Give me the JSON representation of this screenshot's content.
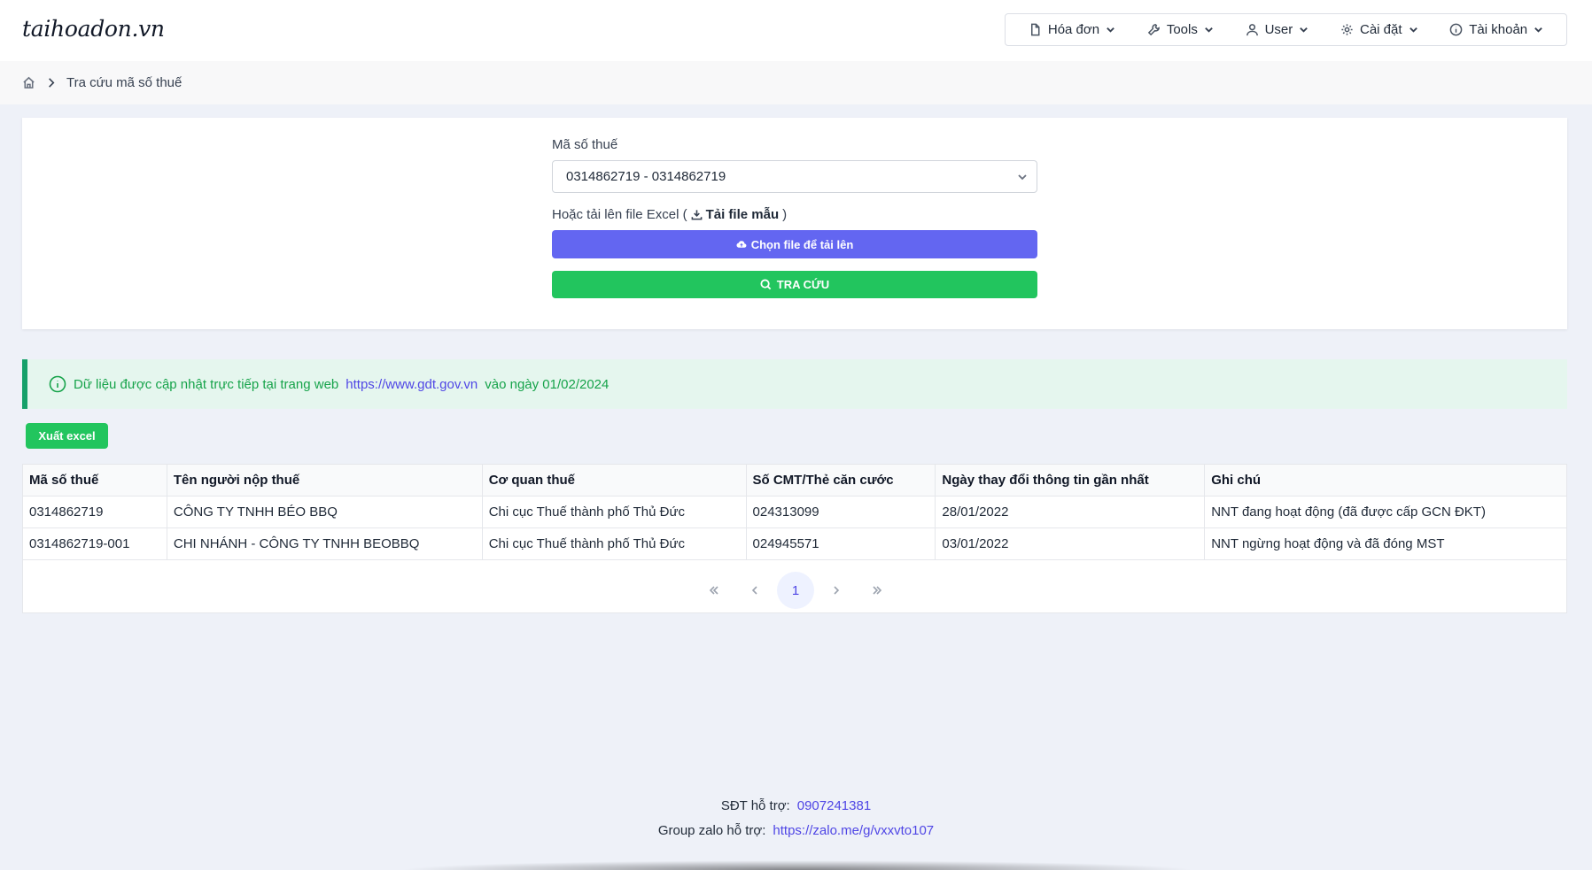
{
  "app": {
    "logo": "taihoadon.vn"
  },
  "nav": {
    "items": [
      {
        "label": "Hóa đơn",
        "icon": "file-icon"
      },
      {
        "label": "Tools",
        "icon": "wrench-icon"
      },
      {
        "label": "User",
        "icon": "user-icon"
      },
      {
        "label": "Cài đặt",
        "icon": "gear-icon"
      },
      {
        "label": "Tài khoản",
        "icon": "info-icon"
      }
    ]
  },
  "breadcrumb": {
    "current": "Tra cứu mã số thuế"
  },
  "search": {
    "label": "Mã số thuế",
    "selected": "0314862719 - 0314862719",
    "upload_prefix": "Hoặc tải lên file Excel (",
    "template_link": "Tải file mẫu",
    "upload_suffix": ")",
    "upload_button": "Chọn file để tải lên",
    "search_button": "TRA CỨU"
  },
  "info": {
    "prefix": "Dữ liệu được cập nhật trực tiếp tại trang web",
    "link": "https://www.gdt.gov.vn",
    "suffix": "vào ngày 01/02/2024"
  },
  "export_button": "Xuất excel",
  "table": {
    "headers": [
      "Mã số thuế",
      "Tên người nộp thuế",
      "Cơ quan thuế",
      "Số CMT/Thẻ căn cước",
      "Ngày thay đổi thông tin gần nhất",
      "Ghi chú"
    ],
    "rows": [
      [
        "0314862719",
        "CÔNG TY TNHH BÉO BBQ",
        "Chi cục Thuế thành phố Thủ Đức",
        "024313099",
        "28/01/2022",
        "NNT đang hoạt động (đã được cấp GCN ĐKT)"
      ],
      [
        "0314862719-001",
        "CHI NHÁNH - CÔNG TY TNHH BEOBBQ",
        "Chi cục Thuế thành phố Thủ Đức",
        "024945571",
        "03/01/2022",
        "NNT ngừng hoạt động và đã đóng MST"
      ]
    ]
  },
  "pagination": {
    "current_page": "1"
  },
  "footer": {
    "phone_label": "SĐT hỗ trợ:",
    "phone": "0907241381",
    "zalo_label": "Group zalo hỗ trợ:",
    "zalo": "https://zalo.me/g/vxxvto107"
  },
  "colors": {
    "primary": "#6366f1",
    "success": "#22c55e",
    "info_bg": "#e5f6ee"
  }
}
